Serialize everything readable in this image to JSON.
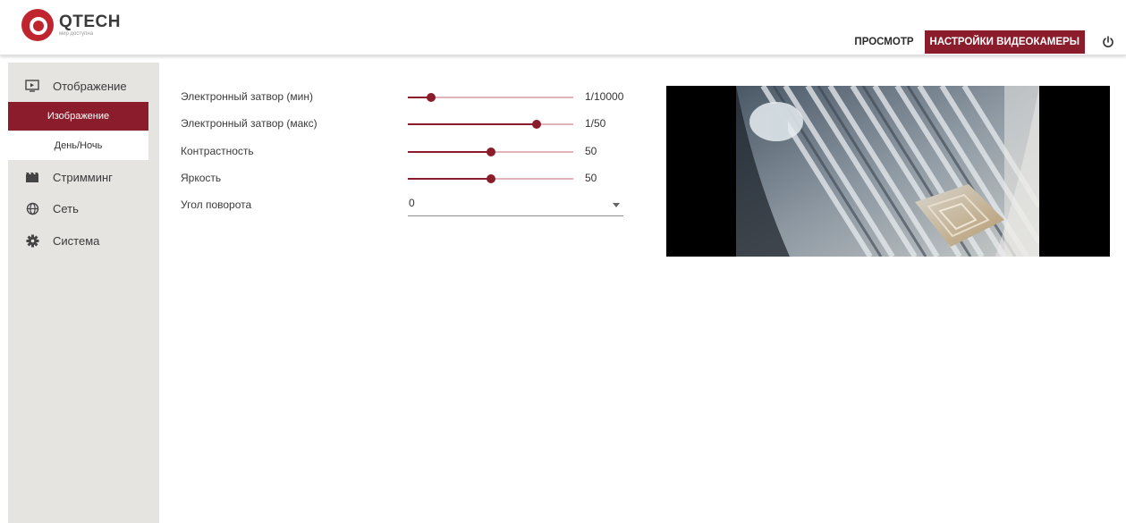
{
  "header": {
    "logo_name": "QTECH",
    "logo_tagline": "мир доступна",
    "nav": [
      {
        "label": "ПРОСМОТР",
        "active": false
      },
      {
        "label": "НАСТРОЙКИ ВИДЕОКАМЕРЫ",
        "active": true
      }
    ],
    "power_icon": "power-icon"
  },
  "sidebar": {
    "items": [
      {
        "label": "Отображение",
        "icon": "display-icon"
      },
      {
        "label": "Стримминг",
        "icon": "film-icon"
      },
      {
        "label": "Сеть",
        "icon": "globe-icon"
      },
      {
        "label": "Система",
        "icon": "gear-icon"
      }
    ],
    "subitems": [
      {
        "label": "Изображение",
        "active": true
      },
      {
        "label": "День/Ночь",
        "active": false
      }
    ]
  },
  "settings": {
    "shutter_min": {
      "label": "Электронный затвор (мин)",
      "value": "1/10000",
      "position": 0.14
    },
    "shutter_max": {
      "label": "Электронный затвор (макс)",
      "value": "1/50",
      "position": 0.78
    },
    "contrast": {
      "label": "Контрастность",
      "value": "50",
      "position": 0.5
    },
    "brightness": {
      "label": "Яркость",
      "value": "50",
      "position": 0.5
    },
    "rotation": {
      "label": "Угол поворота",
      "value": "0"
    }
  },
  "colors": {
    "accent": "#8a1c2b",
    "logo_red": "#c0252f",
    "sidebar_bg": "#e6e4e1",
    "track": "#e0b4b8"
  }
}
